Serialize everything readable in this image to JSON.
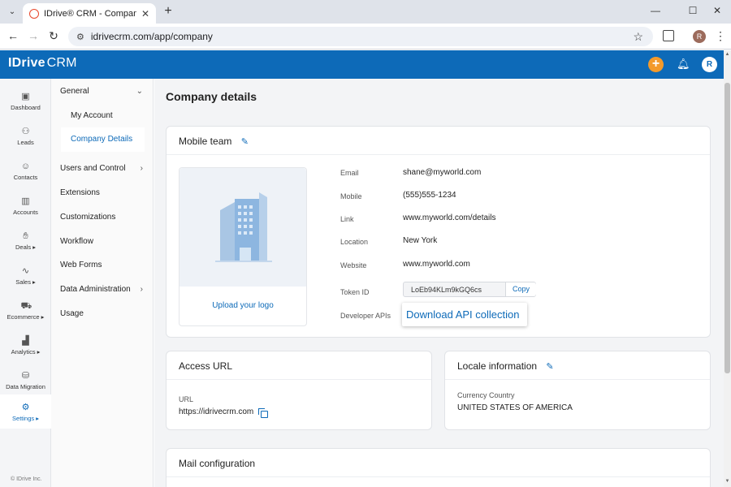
{
  "browser": {
    "tab_title": "IDrive® CRM - Company Details",
    "tab_menu_icon": "chevron-down-icon",
    "new_tab": "+",
    "url": "idrivecrm.com/app/company",
    "profile_initial": "R"
  },
  "header": {
    "logo_brand": "IDrive",
    "logo_product": "CRM",
    "user_initial": "R",
    "colors": {
      "bar": "#0d6ab8",
      "add": "#f39a2b"
    }
  },
  "rail": {
    "items": [
      {
        "label": "Dashboard",
        "icon": "dashboard-icon"
      },
      {
        "label": "Leads",
        "icon": "leads-icon"
      },
      {
        "label": "Contacts",
        "icon": "contacts-icon"
      },
      {
        "label": "Accounts",
        "icon": "accounts-icon"
      },
      {
        "label": "Deals ▸",
        "icon": "deals-icon"
      },
      {
        "label": "Sales ▸",
        "icon": "sales-icon"
      },
      {
        "label": "Ecommerce ▸",
        "icon": "ecommerce-icon"
      },
      {
        "label": "Analytics ▸",
        "icon": "analytics-icon"
      },
      {
        "label": "Data Migration",
        "icon": "data-migration-icon"
      },
      {
        "label": "Settings ▸",
        "icon": "settings-icon"
      }
    ],
    "footer": "© IDrive Inc."
  },
  "sidebar": {
    "general": "General",
    "my_account": "My Account",
    "company_details": "Company Details",
    "users_and_control": "Users and Control",
    "extensions": "Extensions",
    "customizations": "Customizations",
    "workflow": "Workflow",
    "web_forms": "Web Forms",
    "data_administration": "Data Administration",
    "usage": "Usage"
  },
  "main": {
    "page_title": "Company details",
    "company": {
      "name": "Mobile team",
      "upload_logo": "Upload your logo",
      "fields": {
        "email_label": "Email",
        "email": "shane@myworld.com",
        "mobile_label": "Mobile",
        "mobile": "(555)555-1234",
        "link_label": "Link",
        "link": "www.myworld.com/details",
        "location_label": "Location",
        "location": "New York",
        "website_label": "Website",
        "website": "www.myworld.com",
        "token_label": "Token ID",
        "token": "LoEb94KLm9kGQ6cs",
        "copy_label": "Copy",
        "dev_api_label": "Developer APIs",
        "download_api": "Download API collection"
      }
    },
    "access": {
      "title": "Access URL",
      "url_label": "URL",
      "url": "https://idrivecrm.com"
    },
    "locale": {
      "title": "Locale information",
      "currency_label": "Currency Country",
      "currency": "UNITED STATES OF AMERICA"
    },
    "mail": {
      "title": "Mail configuration"
    }
  }
}
